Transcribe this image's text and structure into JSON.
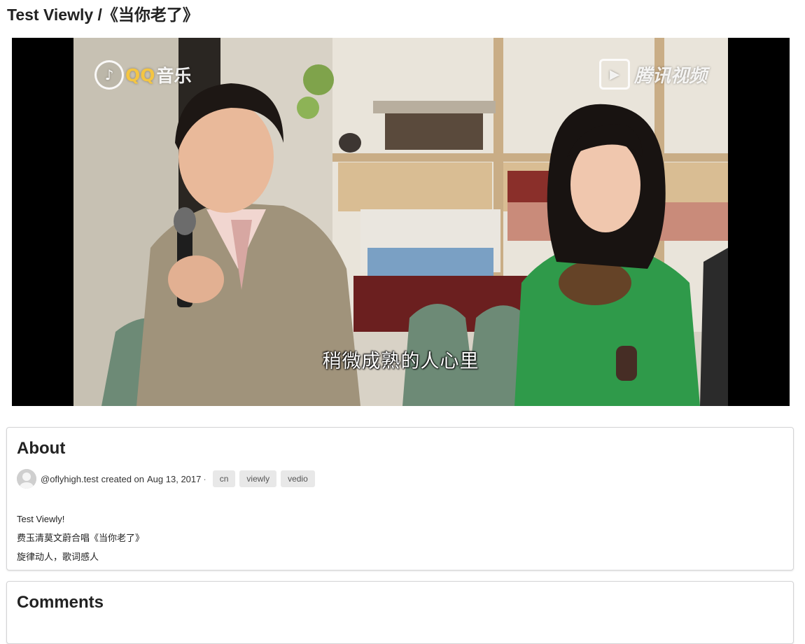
{
  "page": {
    "title": "Test Viewly /《当你老了》"
  },
  "video": {
    "watermark_left_brand": "QQ",
    "watermark_left_text": "音乐",
    "watermark_right_text": "腾讯视频",
    "subtitle": "稍微成熟的人心里"
  },
  "about": {
    "heading": "About",
    "author": "@oflyhigh.test",
    "created_prefix": "created on",
    "date": "Aug 13, 2017",
    "separator": "·",
    "tags": [
      "cn",
      "viewly",
      "vedio"
    ],
    "description": [
      "Test Viewly!",
      "费玉清莫文蔚合唱《当你老了》",
      "旋律动人，歌词感人"
    ]
  },
  "comments": {
    "heading": "Comments"
  },
  "colors": {
    "tag_bg": "#e8e8e8",
    "card_border": "#d4d4d5",
    "text": "#222222"
  }
}
